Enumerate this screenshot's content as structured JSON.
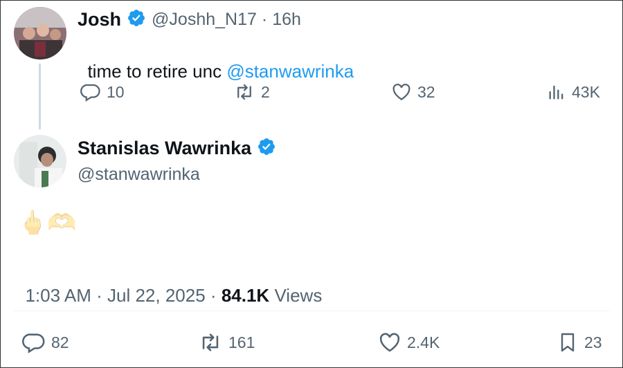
{
  "reply": {
    "display_name": "Josh",
    "handle": "@Joshh_N17",
    "separator": "·",
    "time": "16h",
    "text": "time to retire unc ",
    "mention": "@stanwawrinka",
    "stats": {
      "replies": "10",
      "reposts": "2",
      "likes": "32",
      "views": "43K"
    }
  },
  "main": {
    "display_name": "Stanislas Wawrinka",
    "handle": "@stanwawrinka",
    "emoji": "🖕🫶",
    "time": "1:03 AM",
    "separator1": "·",
    "date": "Jul 22, 2025",
    "separator2": "·",
    "views_count": "84.1K",
    "views_label": "Views",
    "stats": {
      "replies": "82",
      "reposts": "161",
      "likes": "2.4K",
      "bookmarks": "23"
    }
  },
  "colors": {
    "verified": "#1d9bf0",
    "link": "#1d9bf0",
    "muted": "#536471",
    "thread_line": "#cfd9de"
  },
  "icons": [
    "reply-icon",
    "repost-icon",
    "like-icon",
    "views-icon",
    "bookmark-icon",
    "verified-badge-icon"
  ]
}
